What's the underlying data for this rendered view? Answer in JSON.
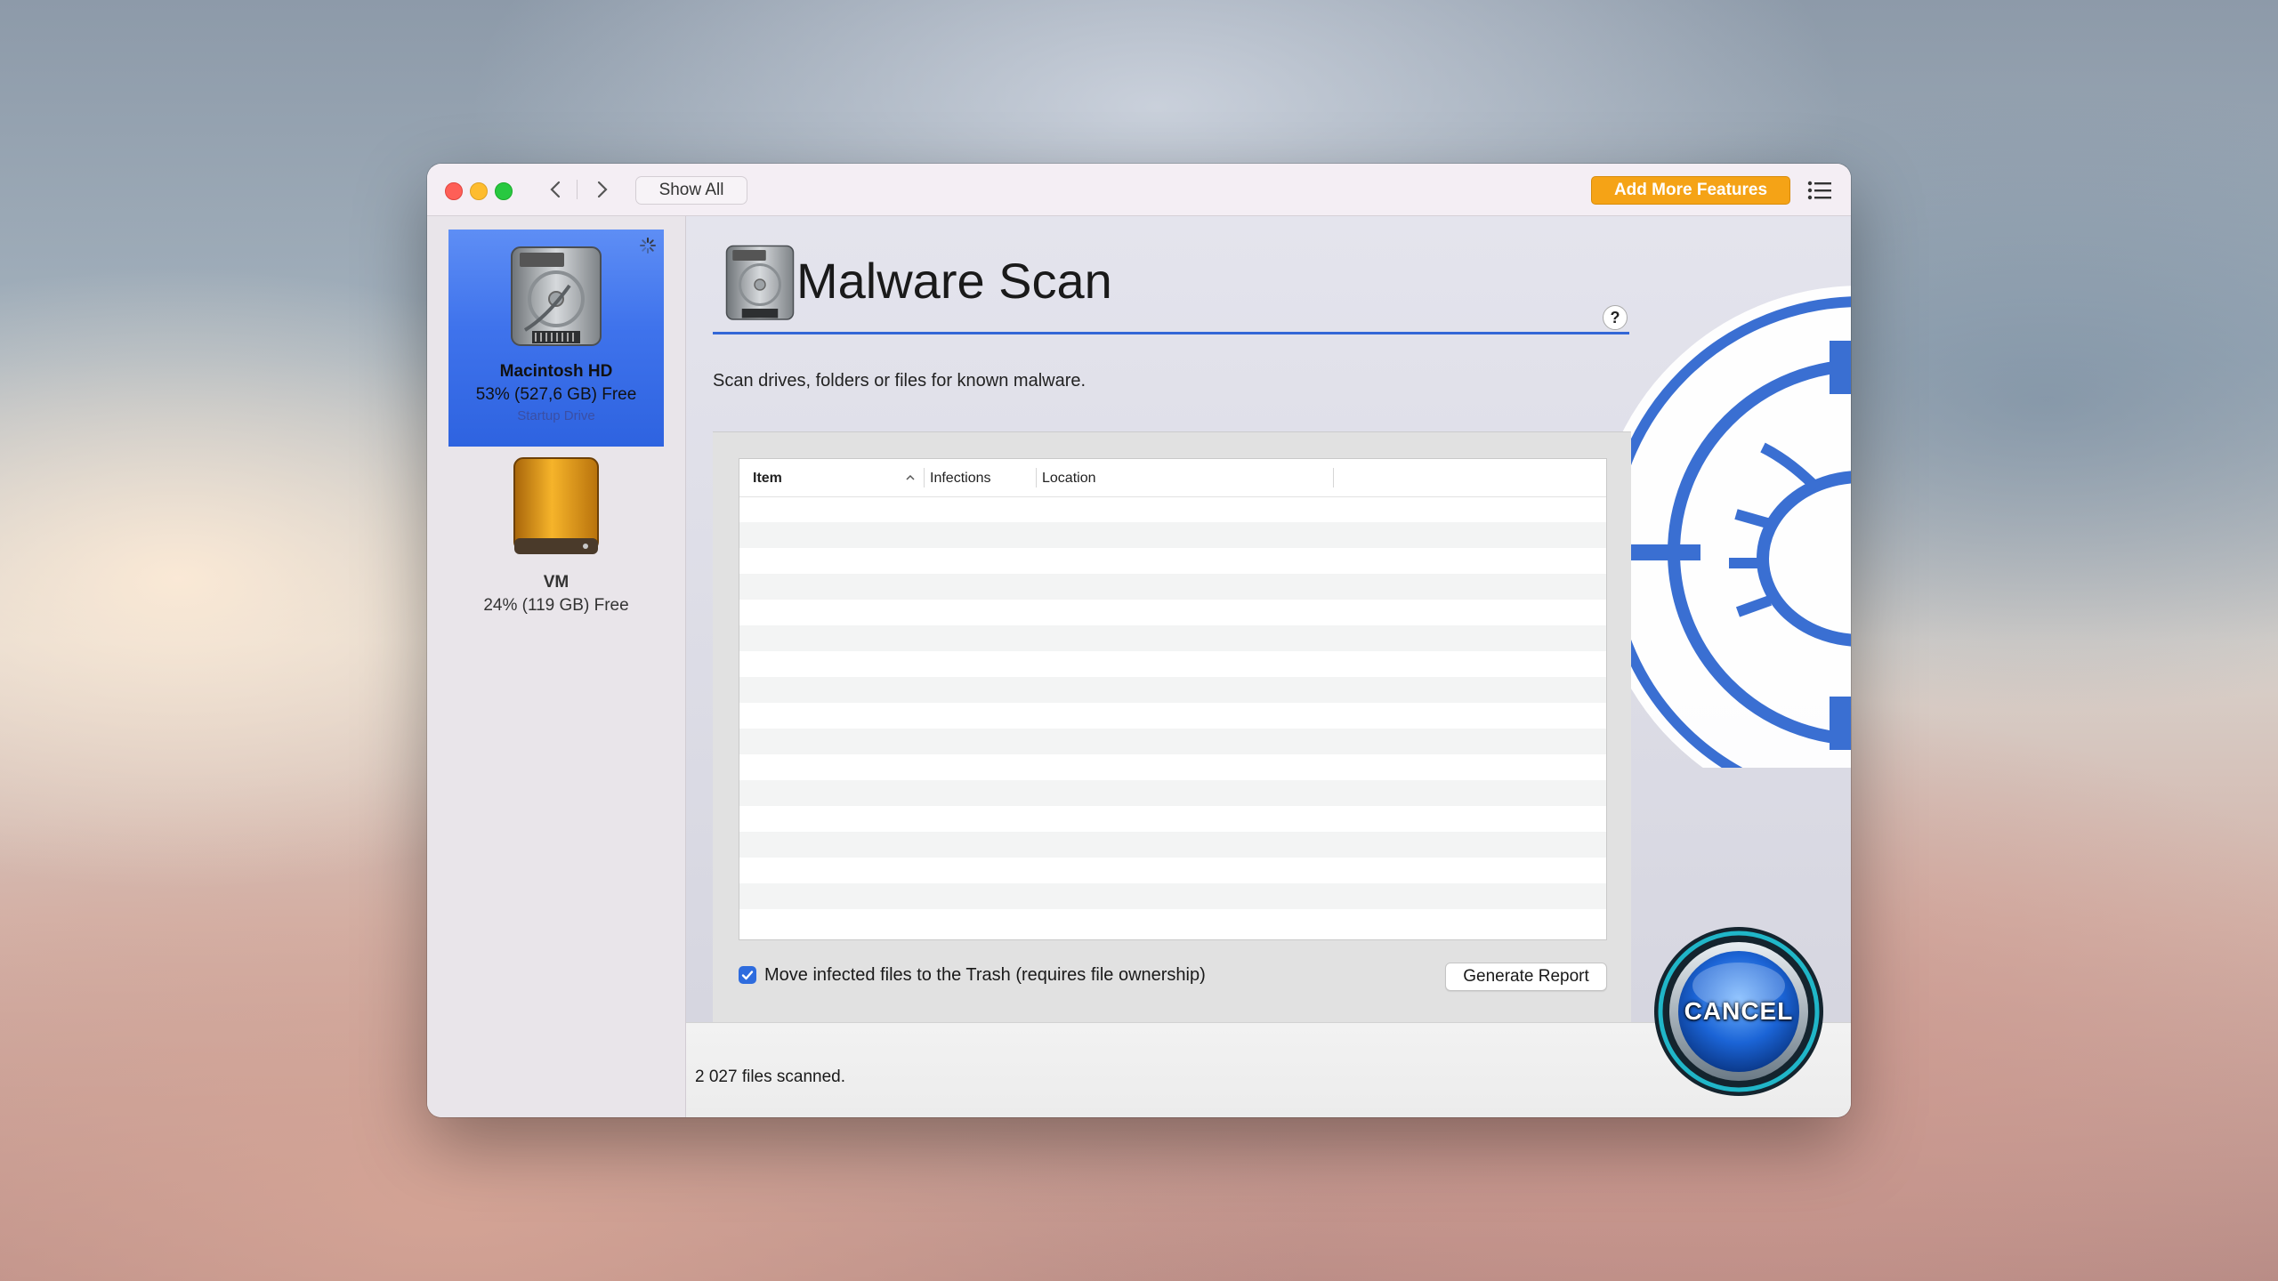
{
  "window": {
    "show_all": "Show All",
    "add_more": "Add More Features"
  },
  "sidebar": {
    "drives": [
      {
        "name": "Macintosh HD",
        "free": "53% (527,6 GB) Free",
        "sub": "Startup Drive",
        "selected": true
      },
      {
        "name": "VM",
        "free": "24% (119 GB) Free",
        "selected": false
      }
    ]
  },
  "main": {
    "title": "Malware Scan",
    "help": "?",
    "description": "Scan drives, folders or files for known malware.",
    "table": {
      "columns": [
        "Item",
        "Infections",
        "Location"
      ],
      "rows": []
    },
    "checkbox_label": "Move infected files to the Trash (requires file ownership)",
    "checkbox_checked": true,
    "generate_report": "Generate Report"
  },
  "status": {
    "text": "2 027 files scanned.",
    "cancel": "CANCEL"
  },
  "colors": {
    "accent": "#3367d6",
    "add_more": "#f5a316",
    "selected_drive": "#3f73ec"
  },
  "icons": [
    "back-icon",
    "forward-icon",
    "list-icon",
    "spinner-icon",
    "hard-drive-icon",
    "external-drive-icon",
    "malware-bug-icon",
    "sort-ascending-icon",
    "checkmark-icon"
  ]
}
